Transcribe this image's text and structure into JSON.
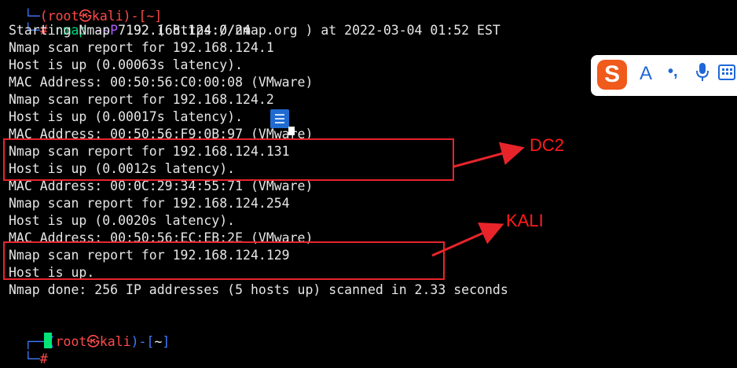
{
  "prompt_top": {
    "corner": "└─",
    "user_partial": "(root㉿kali)-[~]"
  },
  "command": {
    "hash": "#",
    "name": "nmap",
    "flag": "-sP",
    "target": "192.168.124.0/24"
  },
  "output_lines": [
    "Starting Nmap 7.92 ( https://nmap.org ) at 2022-03-04 01:52 EST",
    "Nmap scan report for 192.168.124.1",
    "Host is up (0.00063s latency).",
    "MAC Address: 00:50:56:C0:00:08 (VMware)",
    "Nmap scan report for 192.168.124.2",
    "Host is up (0.00017s latency).",
    "MAC Address: 00:50:56:F9:0B:97 (VMware)",
    "Nmap scan report for 192.168.124.131",
    "Host is up (0.0012s latency).",
    "MAC Address: 00:0C:29:34:55:71 (VMware)",
    "Nmap scan report for 192.168.124.254",
    "Host is up (0.0020s latency).",
    "MAC Address: 00:50:56:EC:EB:2E (VMware)",
    "Nmap scan report for 192.168.124.129",
    "Host is up.",
    "Nmap done: 256 IP addresses (5 hosts up) scanned in 2.33 seconds"
  ],
  "annotations": {
    "dc2": "DC2",
    "kali": "KALI"
  },
  "prompt_bottom": {
    "corner_top": "┌──",
    "open_paren": "(",
    "user": "root",
    "skull": "㉿",
    "host": "kali",
    "close_paren": ")-[",
    "dir": "~",
    "close_bracket": "]",
    "corner_bottom": "└─",
    "hash": "#"
  },
  "ime_toolbar": {
    "logo": "S",
    "mode": "A",
    "punct": "•,",
    "mic_icon": "microphone-icon",
    "keyboard_icon": "keyboard-icon"
  },
  "colors": {
    "prompt": "#3f7bff",
    "root": "#ff4a4a",
    "command": "#00d97e",
    "flag": "#b15cff",
    "highlight": "#e8242b"
  }
}
